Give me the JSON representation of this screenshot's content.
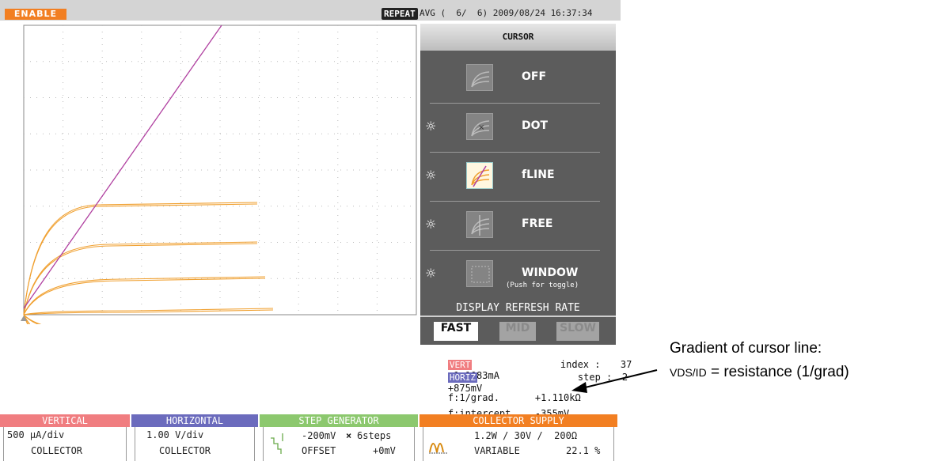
{
  "topbar": {
    "enable_label": "ENABLE",
    "repeat_label": "REPEAT",
    "status": "AVG (  6/  6) 2009/08/24 16:37:34"
  },
  "cursor_menu": {
    "title": "CURSOR",
    "items": [
      {
        "label": "OFF",
        "icon": "curve-family-icon",
        "has_brightness": false,
        "active": false
      },
      {
        "label": "DOT",
        "icon": "curve-dot-icon",
        "has_brightness": true,
        "active": false
      },
      {
        "label": "fLINE",
        "icon": "curve-fline-icon",
        "has_brightness": true,
        "active": true
      },
      {
        "label": "FREE",
        "icon": "curve-free-icon",
        "has_brightness": true,
        "active": false
      },
      {
        "label": "WINDOW",
        "sublabel": "(Push for toggle)",
        "icon": "window-icon",
        "has_brightness": true,
        "active": false
      }
    ]
  },
  "refresh_rate": {
    "title": "DISPLAY REFRESH RATE",
    "options": [
      "FAST",
      "MID",
      "SLOW"
    ],
    "selected": "FAST"
  },
  "readout": {
    "vert_badge": "VERT",
    "vert_value": "+1.1083mA",
    "index_label": "index :",
    "index_value": "37",
    "horiz_badge": "HORIZ",
    "horiz_value": "+875mV",
    "step_label": "step :",
    "step_value": "2",
    "grad_label": "f:1/grad.",
    "grad_value": "+1.110kΩ",
    "intercept_label": "f:intercept",
    "intercept_value": "-355mV"
  },
  "annotation": {
    "line1": "Gradient of cursor line:",
    "line2_vds": "VDS/ID",
    "line2_rest": " = resistance (1/grad)"
  },
  "panels": {
    "vertical": {
      "title": "VERTICAL",
      "scale": "500 μA/div",
      "source": "COLLECTOR",
      "color": "#f07d80"
    },
    "horizontal": {
      "title": "HORIZONTAL",
      "scale": "1.00 V/div",
      "source": "COLLECTOR",
      "color": "#6b6bbd"
    },
    "step_generator": {
      "title": "STEP GENERATOR",
      "step": "-200mV",
      "times": "×",
      "steps": "6steps",
      "offset_label": "OFFSET",
      "offset_value": "+0mV",
      "color": "#8cc86e"
    },
    "collector_supply": {
      "title": "COLLECTOR SUPPLY",
      "ratings": "1.2W / 30V /  200Ω",
      "mode": "VARIABLE",
      "percent": "22.1 %",
      "color": "#f27f22"
    }
  },
  "colors": {
    "trace": "#f0a030",
    "cursor_line": "#b040a0",
    "menu_bg": "#5c5c5c"
  }
}
